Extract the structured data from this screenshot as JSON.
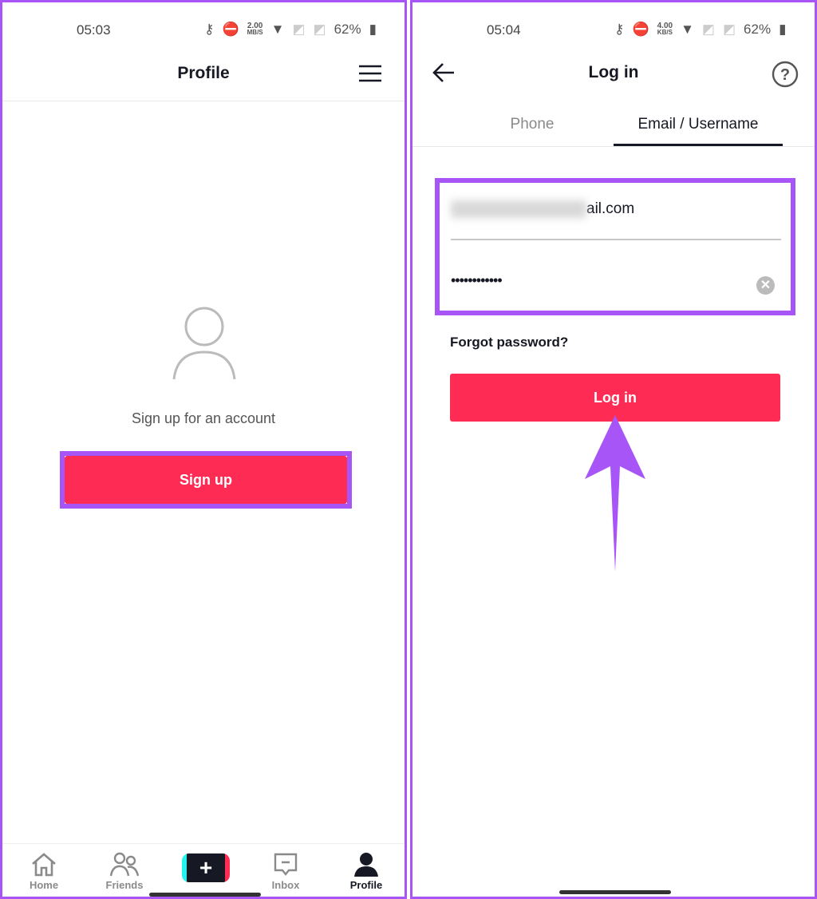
{
  "left": {
    "status": {
      "time": "05:03",
      "speed_value": "2.00",
      "speed_unit": "MB/S",
      "battery": "62%"
    },
    "header": {
      "title": "Profile",
      "menu_icon": "hamburger-icon"
    },
    "empty_state": {
      "icon": "person-outline-icon",
      "text": "Sign up for an account"
    },
    "signup_label": "Sign up",
    "nav": [
      {
        "label": "Home",
        "icon": "home-icon"
      },
      {
        "label": "Friends",
        "icon": "friends-icon"
      },
      {
        "label": "",
        "icon": "plus-icon"
      },
      {
        "label": "Inbox",
        "icon": "inbox-icon"
      },
      {
        "label": "Profile",
        "icon": "profile-icon",
        "active": true
      }
    ]
  },
  "right": {
    "status": {
      "time": "05:04",
      "speed_value": "4.00",
      "speed_unit": "KB/S",
      "battery": "62%"
    },
    "header": {
      "title": "Log in",
      "back_icon": "arrow-left-icon",
      "help_icon": "question-circle-icon"
    },
    "tabs": [
      {
        "label": "Phone",
        "active": false
      },
      {
        "label": "Email / Username",
        "active": true
      }
    ],
    "email_value": "ail.com",
    "password_value": "••••••••••••",
    "forgot_label": "Forgot password?",
    "login_label": "Log in"
  },
  "colors": {
    "accent": "#fe2c55",
    "highlight": "#a855f7"
  }
}
